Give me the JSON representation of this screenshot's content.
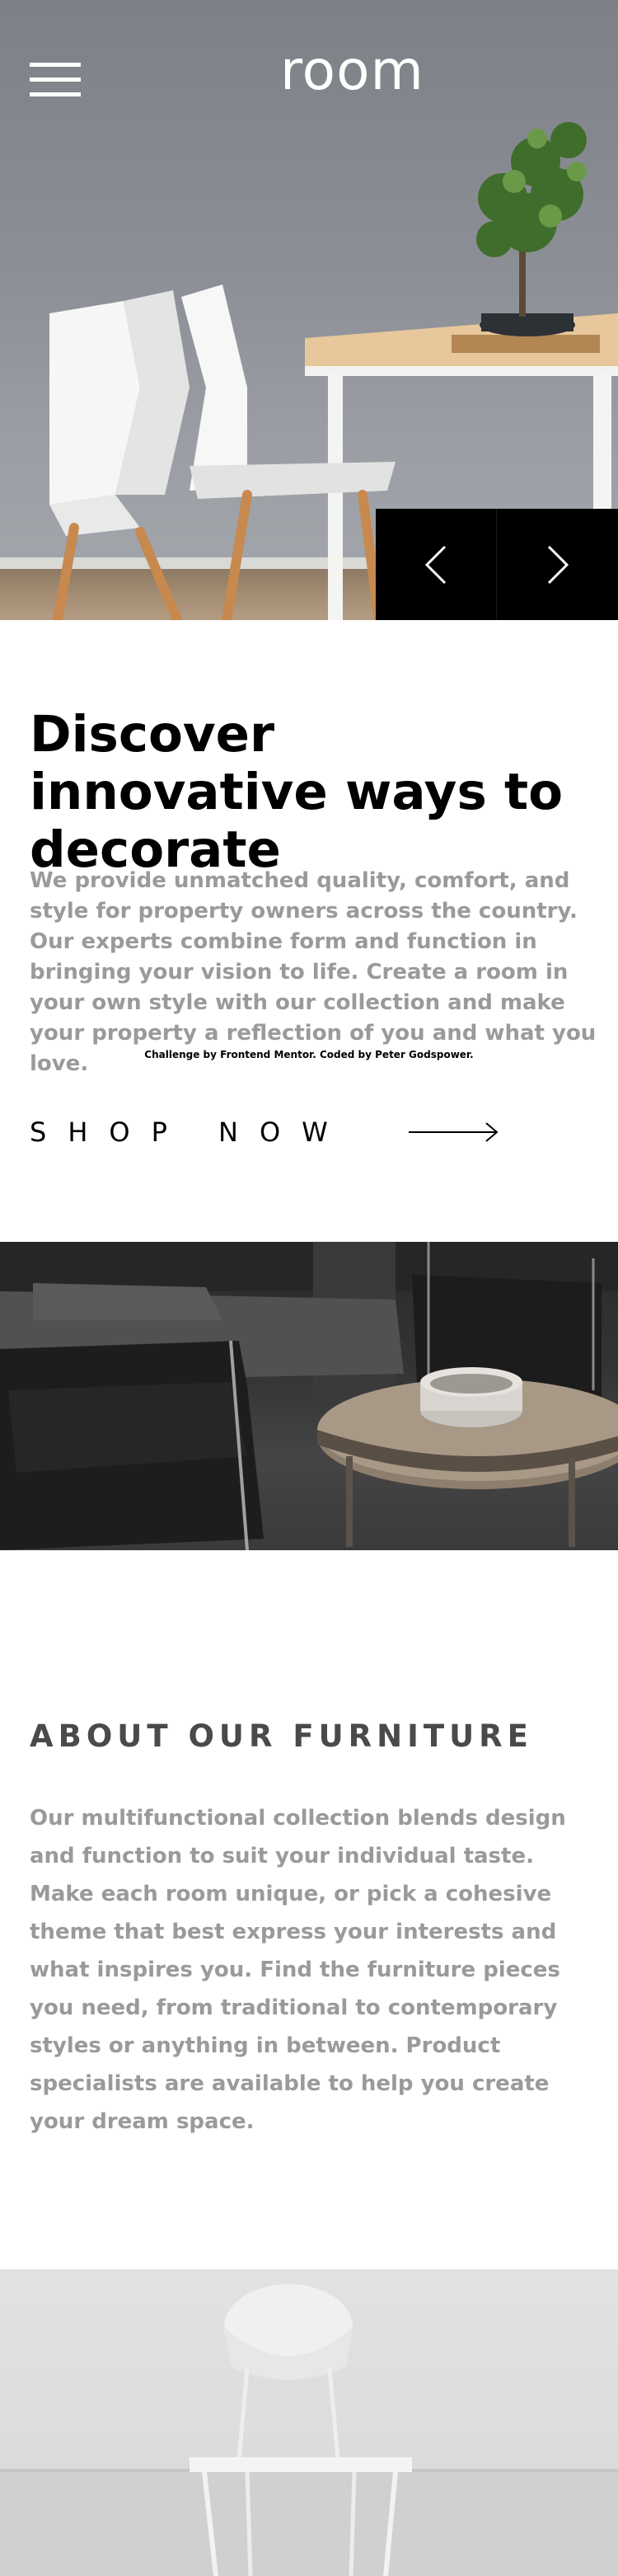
{
  "header": {
    "logo_text": "room",
    "menu_icon": "hamburger-menu-icon"
  },
  "hero": {
    "prev_icon": "angle-left-icon",
    "next_icon": "angle-right-icon"
  },
  "intro": {
    "title": "Discover innovative ways to decorate",
    "description": "We provide unmatched quality, comfort, and style for property owners across the country. Our experts combine form and function in bringing your vision to life. Create a room in your own style with our collection and make your property a reflection of you and what you love.",
    "attribution": "Challenge by Frontend Mentor. Coded by Peter Godspower.",
    "cta_label": "SHOP NOW",
    "cta_icon": "arrow-right-icon"
  },
  "about": {
    "title": "ABOUT OUR FURNITURE",
    "description": "Our multifunctional collection blends design and function to suit your individual taste. Make each room unique, or pick a cohesive theme that best express your interests and what inspires you. Find the furniture pieces you need, from traditional to contemporary styles or anything in between. Product specialists are available to help you create your dream space."
  },
  "colors": {
    "text_primary": "#000000",
    "text_muted": "#9a9a9a",
    "heading_gray": "#4a4a4a",
    "nav_background": "#000000",
    "page_background": "#ffffff"
  }
}
